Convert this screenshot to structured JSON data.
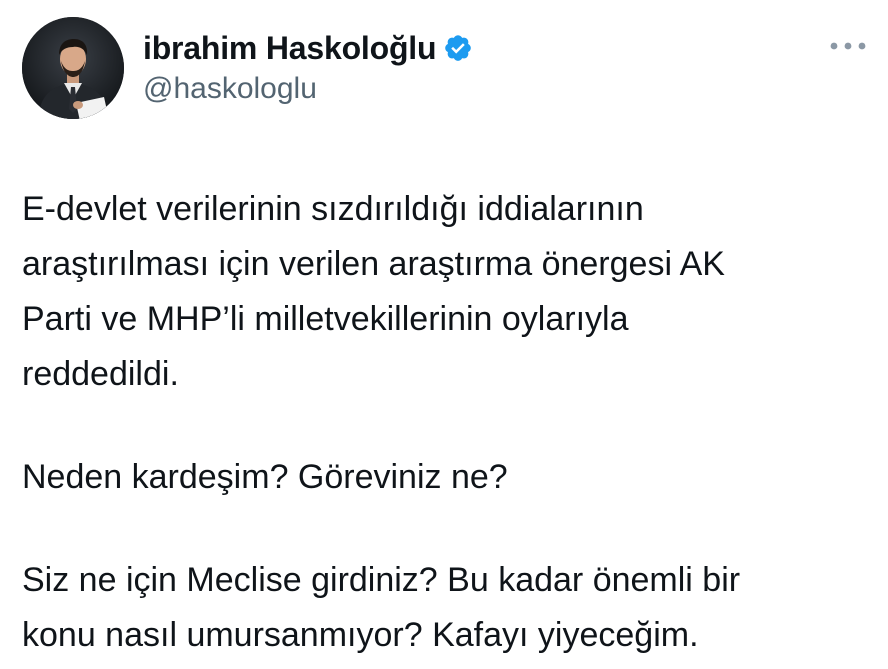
{
  "author": {
    "display_name": "ibrahim Haskoloğlu",
    "handle": "@haskologlu",
    "verified": true,
    "avatar_icon": "profile-photo-man-in-suit"
  },
  "menu": {
    "more_icon": "more-horizontal-icon"
  },
  "colors": {
    "verified_badge": "#1d9bf0",
    "text_primary": "#0f1419",
    "text_secondary": "#536471",
    "more_icon": "#8b98a5"
  },
  "tweet": {
    "paragraphs": [
      {
        "lines": [
          "E-devlet verilerinin sızdırıldığı iddialarının",
          "araştırılması için verilen araştırma önergesi AK",
          "Parti ve MHP’li milletvekillerinin oylarıyla",
          "reddedildi."
        ]
      },
      {
        "lines": [
          "Neden kardeşim? Göreviniz ne?"
        ]
      },
      {
        "lines": [
          "Siz ne için Meclise girdiniz? Bu kadar önemli bir",
          "konu nasıl umursanmıyor? Kafayı yiyeceğim."
        ]
      }
    ]
  }
}
